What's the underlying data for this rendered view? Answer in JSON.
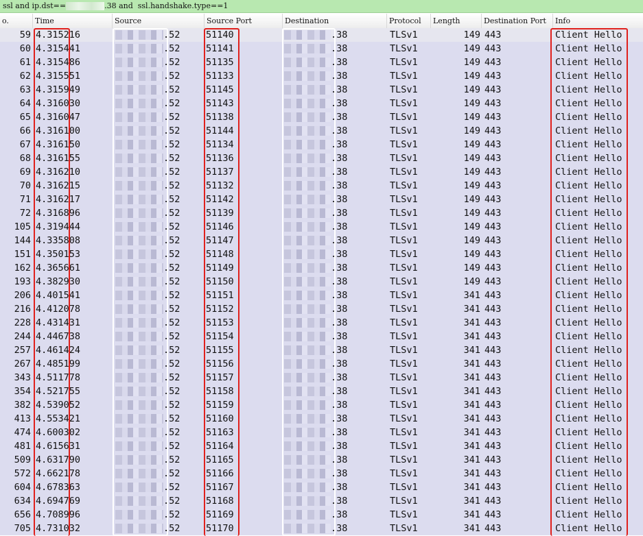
{
  "filter": {
    "prefix": "ssl and ip.dst==",
    "suffix": ".38 and  ssl.handshake.type==1"
  },
  "columns": {
    "no": "o.",
    "time": "Time",
    "source": "Source",
    "source_port": "Source Port",
    "destination": "Destination",
    "protocol": "Protocol",
    "length": "Length",
    "destination_port": "Destination Port",
    "info": "Info"
  },
  "rows": [
    {
      "no": "59",
      "time": "4.315216",
      "src": ".52",
      "sport": "51140",
      "dst": ".38",
      "proto": "TLSv1",
      "len": "149",
      "dport": "443",
      "info": "Client Hello"
    },
    {
      "no": "60",
      "time": "4.315441",
      "src": ".52",
      "sport": "51141",
      "dst": ".38",
      "proto": "TLSv1",
      "len": "149",
      "dport": "443",
      "info": "Client Hello"
    },
    {
      "no": "61",
      "time": "4.315486",
      "src": ".52",
      "sport": "51135",
      "dst": ".38",
      "proto": "TLSv1",
      "len": "149",
      "dport": "443",
      "info": "Client Hello"
    },
    {
      "no": "62",
      "time": "4.315551",
      "src": ".52",
      "sport": "51133",
      "dst": ".38",
      "proto": "TLSv1",
      "len": "149",
      "dport": "443",
      "info": "Client Hello"
    },
    {
      "no": "63",
      "time": "4.315949",
      "src": ".52",
      "sport": "51145",
      "dst": ".38",
      "proto": "TLSv1",
      "len": "149",
      "dport": "443",
      "info": "Client Hello"
    },
    {
      "no": "64",
      "time": "4.316030",
      "src": ".52",
      "sport": "51143",
      "dst": ".38",
      "proto": "TLSv1",
      "len": "149",
      "dport": "443",
      "info": "Client Hello"
    },
    {
      "no": "65",
      "time": "4.316047",
      "src": ".52",
      "sport": "51138",
      "dst": ".38",
      "proto": "TLSv1",
      "len": "149",
      "dport": "443",
      "info": "Client Hello"
    },
    {
      "no": "66",
      "time": "4.316100",
      "src": ".52",
      "sport": "51144",
      "dst": ".38",
      "proto": "TLSv1",
      "len": "149",
      "dport": "443",
      "info": "Client Hello"
    },
    {
      "no": "67",
      "time": "4.316150",
      "src": ".52",
      "sport": "51134",
      "dst": ".38",
      "proto": "TLSv1",
      "len": "149",
      "dport": "443",
      "info": "Client Hello"
    },
    {
      "no": "68",
      "time": "4.316155",
      "src": ".52",
      "sport": "51136",
      "dst": ".38",
      "proto": "TLSv1",
      "len": "149",
      "dport": "443",
      "info": "Client Hello"
    },
    {
      "no": "69",
      "time": "4.316210",
      "src": ".52",
      "sport": "51137",
      "dst": ".38",
      "proto": "TLSv1",
      "len": "149",
      "dport": "443",
      "info": "Client Hello"
    },
    {
      "no": "70",
      "time": "4.316215",
      "src": ".52",
      "sport": "51132",
      "dst": ".38",
      "proto": "TLSv1",
      "len": "149",
      "dport": "443",
      "info": "Client Hello"
    },
    {
      "no": "71",
      "time": "4.316217",
      "src": ".52",
      "sport": "51142",
      "dst": ".38",
      "proto": "TLSv1",
      "len": "149",
      "dport": "443",
      "info": "Client Hello"
    },
    {
      "no": "72",
      "time": "4.316896",
      "src": ".52",
      "sport": "51139",
      "dst": ".38",
      "proto": "TLSv1",
      "len": "149",
      "dport": "443",
      "info": "Client Hello"
    },
    {
      "no": "105",
      "time": "4.319444",
      "src": ".52",
      "sport": "51146",
      "dst": ".38",
      "proto": "TLSv1",
      "len": "149",
      "dport": "443",
      "info": "Client Hello"
    },
    {
      "no": "144",
      "time": "4.335808",
      "src": ".52",
      "sport": "51147",
      "dst": ".38",
      "proto": "TLSv1",
      "len": "149",
      "dport": "443",
      "info": "Client Hello"
    },
    {
      "no": "151",
      "time": "4.350153",
      "src": ".52",
      "sport": "51148",
      "dst": ".38",
      "proto": "TLSv1",
      "len": "149",
      "dport": "443",
      "info": "Client Hello"
    },
    {
      "no": "162",
      "time": "4.365661",
      "src": ".52",
      "sport": "51149",
      "dst": ".38",
      "proto": "TLSv1",
      "len": "149",
      "dport": "443",
      "info": "Client Hello"
    },
    {
      "no": "193",
      "time": "4.382930",
      "src": ".52",
      "sport": "51150",
      "dst": ".38",
      "proto": "TLSv1",
      "len": "149",
      "dport": "443",
      "info": "Client Hello"
    },
    {
      "no": "206",
      "time": "4.401541",
      "src": ".52",
      "sport": "51151",
      "dst": ".38",
      "proto": "TLSv1",
      "len": "341",
      "dport": "443",
      "info": "Client Hello"
    },
    {
      "no": "216",
      "time": "4.412078",
      "src": ".52",
      "sport": "51152",
      "dst": ".38",
      "proto": "TLSv1",
      "len": "341",
      "dport": "443",
      "info": "Client Hello"
    },
    {
      "no": "228",
      "time": "4.431431",
      "src": ".52",
      "sport": "51153",
      "dst": ".38",
      "proto": "TLSv1",
      "len": "341",
      "dport": "443",
      "info": "Client Hello"
    },
    {
      "no": "244",
      "time": "4.446738",
      "src": ".52",
      "sport": "51154",
      "dst": ".38",
      "proto": "TLSv1",
      "len": "341",
      "dport": "443",
      "info": "Client Hello"
    },
    {
      "no": "257",
      "time": "4.461424",
      "src": ".52",
      "sport": "51155",
      "dst": ".38",
      "proto": "TLSv1",
      "len": "341",
      "dport": "443",
      "info": "Client Hello"
    },
    {
      "no": "267",
      "time": "4.485199",
      "src": ".52",
      "sport": "51156",
      "dst": ".38",
      "proto": "TLSv1",
      "len": "341",
      "dport": "443",
      "info": "Client Hello"
    },
    {
      "no": "343",
      "time": "4.511778",
      "src": ".52",
      "sport": "51157",
      "dst": ".38",
      "proto": "TLSv1",
      "len": "341",
      "dport": "443",
      "info": "Client Hello"
    },
    {
      "no": "354",
      "time": "4.521755",
      "src": ".52",
      "sport": "51158",
      "dst": ".38",
      "proto": "TLSv1",
      "len": "341",
      "dport": "443",
      "info": "Client Hello"
    },
    {
      "no": "382",
      "time": "4.539052",
      "src": ".52",
      "sport": "51159",
      "dst": ".38",
      "proto": "TLSv1",
      "len": "341",
      "dport": "443",
      "info": "Client Hello"
    },
    {
      "no": "413",
      "time": "4.553421",
      "src": ".52",
      "sport": "51160",
      "dst": ".38",
      "proto": "TLSv1",
      "len": "341",
      "dport": "443",
      "info": "Client Hello"
    },
    {
      "no": "474",
      "time": "4.600302",
      "src": ".52",
      "sport": "51163",
      "dst": ".38",
      "proto": "TLSv1",
      "len": "341",
      "dport": "443",
      "info": "Client Hello"
    },
    {
      "no": "481",
      "time": "4.615631",
      "src": ".52",
      "sport": "51164",
      "dst": ".38",
      "proto": "TLSv1",
      "len": "341",
      "dport": "443",
      "info": "Client Hello"
    },
    {
      "no": "509",
      "time": "4.631790",
      "src": ".52",
      "sport": "51165",
      "dst": ".38",
      "proto": "TLSv1",
      "len": "341",
      "dport": "443",
      "info": "Client Hello"
    },
    {
      "no": "572",
      "time": "4.662178",
      "src": ".52",
      "sport": "51166",
      "dst": ".38",
      "proto": "TLSv1",
      "len": "341",
      "dport": "443",
      "info": "Client Hello"
    },
    {
      "no": "604",
      "time": "4.678363",
      "src": ".52",
      "sport": "51167",
      "dst": ".38",
      "proto": "TLSv1",
      "len": "341",
      "dport": "443",
      "info": "Client Hello"
    },
    {
      "no": "634",
      "time": "4.694769",
      "src": ".52",
      "sport": "51168",
      "dst": ".38",
      "proto": "TLSv1",
      "len": "341",
      "dport": "443",
      "info": "Client Hello"
    },
    {
      "no": "656",
      "time": "4.708996",
      "src": ".52",
      "sport": "51169",
      "dst": ".38",
      "proto": "TLSv1",
      "len": "341",
      "dport": "443",
      "info": "Client Hello"
    },
    {
      "no": "705",
      "time": "4.731032",
      "src": ".52",
      "sport": "51170",
      "dst": ".38",
      "proto": "TLSv1",
      "len": "341",
      "dport": "443",
      "info": "Client Hello"
    }
  ],
  "colors": {
    "filter_bg": "#b8e8b0",
    "row_bg": "#dcdcef",
    "selected_bg": "#e6e6ef",
    "highlight_box": "#e0201c"
  }
}
